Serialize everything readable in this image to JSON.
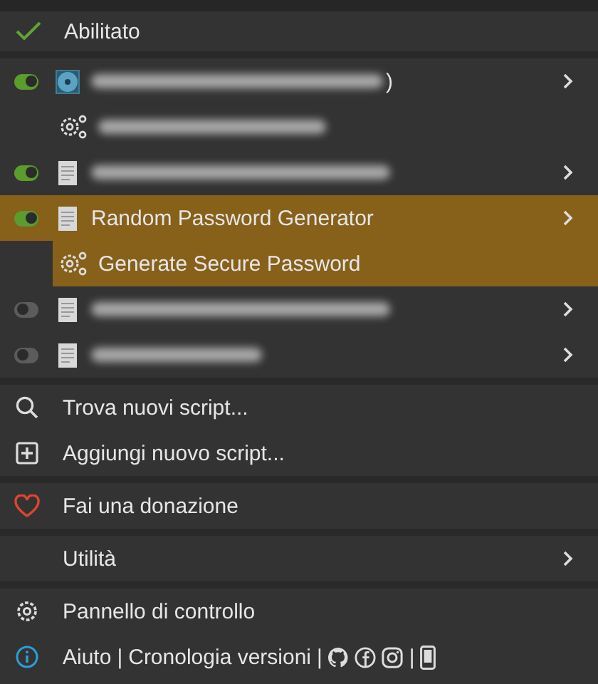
{
  "header": {
    "label": "Abilitato",
    "checked": true
  },
  "scripts": [
    {
      "enabled": true,
      "blurred": true,
      "label_end": ")",
      "selected": false,
      "has_submenu": true,
      "commands": [
        {
          "blurred": true,
          "selected": false
        }
      ]
    },
    {
      "enabled": true,
      "blurred": true,
      "selected": false,
      "has_submenu": true
    },
    {
      "enabled": true,
      "label": "Random Password Generator",
      "selected": true,
      "has_submenu": true,
      "commands": [
        {
          "label": "Generate Secure Password",
          "selected": true
        }
      ]
    },
    {
      "enabled": false,
      "blurred": true,
      "selected": false,
      "has_submenu": true
    },
    {
      "enabled": false,
      "blurred": true,
      "selected": false,
      "has_submenu": true
    }
  ],
  "actions": [
    [
      {
        "label": "Trova nuovi script..."
      },
      {
        "label": "Aggiungi nuovo script..."
      }
    ],
    [
      {
        "label": "Fai una donazione"
      }
    ],
    [
      {
        "label": "Utilità",
        "has_submenu": true
      }
    ],
    [
      {
        "label": "Pannello di controllo"
      },
      {
        "kind": "footer",
        "parts": [
          {
            "kind": "link",
            "label": "Aiuto"
          },
          {
            "kind": "sep",
            "label": "|"
          },
          {
            "kind": "link",
            "label": "Cronologia versioni"
          },
          {
            "kind": "sep",
            "label": "|"
          },
          {
            "kind": "icon"
          },
          {
            "kind": "icon"
          },
          {
            "kind": "icon"
          },
          {
            "kind": "sep",
            "label": "|"
          },
          {
            "kind": "icon"
          }
        ]
      }
    ]
  ]
}
